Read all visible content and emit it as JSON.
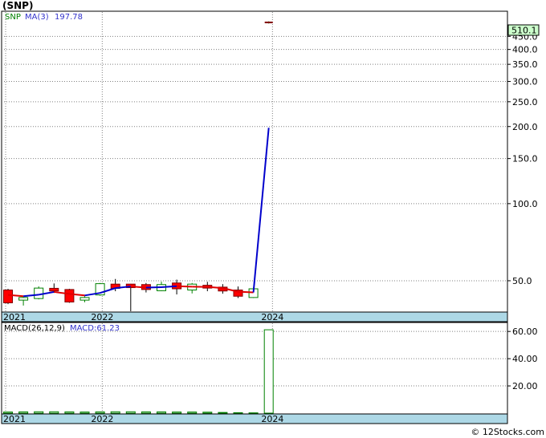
{
  "ticker_label": "(SNP)",
  "credit": "© 12Stocks.com",
  "colors": {
    "up": "#ffffff",
    "up_border": "#008000",
    "down": "#ff0000",
    "ma_down": "#e00000",
    "ma_up": "#0000cc",
    "grid": "#808080",
    "axis_band": "#add8e6",
    "price_tag_bg": "#ccffcc",
    "macd_text": "#3333cc"
  },
  "chart_data": [
    {
      "type": "candlestick",
      "scale": "log",
      "ylim": [
        38,
        560
      ],
      "legend": {
        "symbol": "SNP",
        "ma_label": "MA(3)",
        "ma_value": "197.78"
      },
      "last_price_tag": "510.1",
      "yticks": [
        "50.0",
        "100.0",
        "150.0",
        "200.0",
        "250.0",
        "300.0",
        "350.0",
        "400.0",
        "450.0"
      ],
      "ytick_values": [
        50,
        100,
        150,
        200,
        250,
        300,
        350,
        400,
        450
      ],
      "xticks": [
        {
          "label": "2021",
          "index": 0
        },
        {
          "label": "2022",
          "index": 6.3
        },
        {
          "label": "2024",
          "index": 17.4
        }
      ],
      "candles": [
        {
          "o": 46.0,
          "h": 46.5,
          "l": 40.5,
          "c": 41.0
        },
        {
          "o": 42.0,
          "h": 43.2,
          "l": 40.0,
          "c": 43.0
        },
        {
          "o": 42.6,
          "h": 47.5,
          "l": 42.3,
          "c": 46.8
        },
        {
          "o": 46.7,
          "h": 48.8,
          "l": 44.8,
          "c": 45.6
        },
        {
          "o": 46.2,
          "h": 46.5,
          "l": 41.0,
          "c": 41.3
        },
        {
          "o": 42.0,
          "h": 43.5,
          "l": 41.2,
          "c": 43.0
        },
        {
          "o": 44.0,
          "h": 49.0,
          "l": 43.7,
          "c": 48.7
        },
        {
          "o": 48.5,
          "h": 50.8,
          "l": 45.5,
          "c": 46.7
        },
        {
          "o": 48.5,
          "h": 48.6,
          "l": 38.0,
          "c": 47.0
        },
        {
          "o": 48.3,
          "h": 49.0,
          "l": 45.0,
          "c": 46.2
        },
        {
          "o": 45.7,
          "h": 49.6,
          "l": 45.5,
          "c": 48.3
        },
        {
          "o": 49.0,
          "h": 50.5,
          "l": 44.2,
          "c": 46.5
        },
        {
          "o": 46.0,
          "h": 49.0,
          "l": 44.6,
          "c": 48.5
        },
        {
          "o": 48.0,
          "h": 49.5,
          "l": 45.5,
          "c": 46.8
        },
        {
          "o": 47.2,
          "h": 48.5,
          "l": 44.5,
          "c": 45.6
        },
        {
          "o": 46.0,
          "h": 47.5,
          "l": 42.8,
          "c": 43.5
        },
        {
          "o": 43.0,
          "h": 47.0,
          "l": 42.8,
          "c": 46.5
        },
        {
          "o": 510.1,
          "h": 515.0,
          "l": 505.0,
          "c": 510.1
        }
      ],
      "ma": [
        44.0,
        43.5,
        44.1,
        45.2,
        44.4,
        43.8,
        44.8,
        46.8,
        47.5,
        47.0,
        47.2,
        47.6,
        47.4,
        47.3,
        46.8,
        45.3,
        45.0,
        197.78
      ],
      "ma_colors": [
        "down",
        "down",
        "up",
        "up",
        "down",
        "down",
        "up",
        "up",
        "up",
        "down",
        "up",
        "up",
        "down",
        "down",
        "down",
        "down",
        "down",
        "up"
      ]
    },
    {
      "type": "bar",
      "legend": {
        "label": "MACD(26,12,9)",
        "value_label": "MACD:61.23"
      },
      "ylim": [
        0,
        66
      ],
      "yticks": [
        "20.00",
        "40.00",
        "60.00"
      ],
      "ytick_values": [
        20,
        40,
        60
      ],
      "xticks": [
        {
          "label": "2021",
          "index": 0
        },
        {
          "label": "2022",
          "index": 6.3
        },
        {
          "label": "2024",
          "index": 17.4
        }
      ],
      "values": [
        0.8,
        0.9,
        1.0,
        1.0,
        0.9,
        0.8,
        0.9,
        1.0,
        1.0,
        0.9,
        0.9,
        0.8,
        0.8,
        0.7,
        0.5,
        0.3,
        0.2,
        61.23
      ]
    }
  ]
}
